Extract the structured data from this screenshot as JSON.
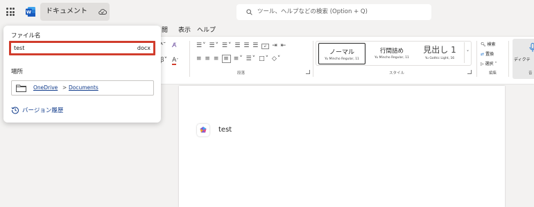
{
  "titlebar": {
    "doc_name": "ドキュメント",
    "search_placeholder": "ツール、ヘルプなどの検索 (Option + Q)"
  },
  "tabs": [
    "閲",
    "表示",
    "ヘルプ"
  ],
  "ribbon": {
    "paragraph_group": "段落",
    "styles_group": "スタイル",
    "edit_group": "編集",
    "voice_group": "音",
    "styles": [
      {
        "name": "ノーマル",
        "font": "Yu Mincho Regular, 11"
      },
      {
        "name": "行間詰め",
        "font": "Yu Mincho Regular, 11"
      },
      {
        "name": "見出し 1",
        "font": "Yu Gothic Light, 16"
      }
    ],
    "edit_items": [
      "検索",
      "置換",
      "選択"
    ],
    "dictate": "ディクテ"
  },
  "popup": {
    "filename_label": "ファイル名",
    "filename_value": "test",
    "extension": "docx",
    "location_label": "場所",
    "location_root": "OneDrive",
    "location_sep": ">",
    "location_folder": "Documents",
    "version_history": "バージョン履歴"
  },
  "document": {
    "text": "test"
  },
  "colors": {
    "accent_red": "#d13c2c",
    "link_blue": "#0f3a8a",
    "word_blue": "#185abd"
  }
}
